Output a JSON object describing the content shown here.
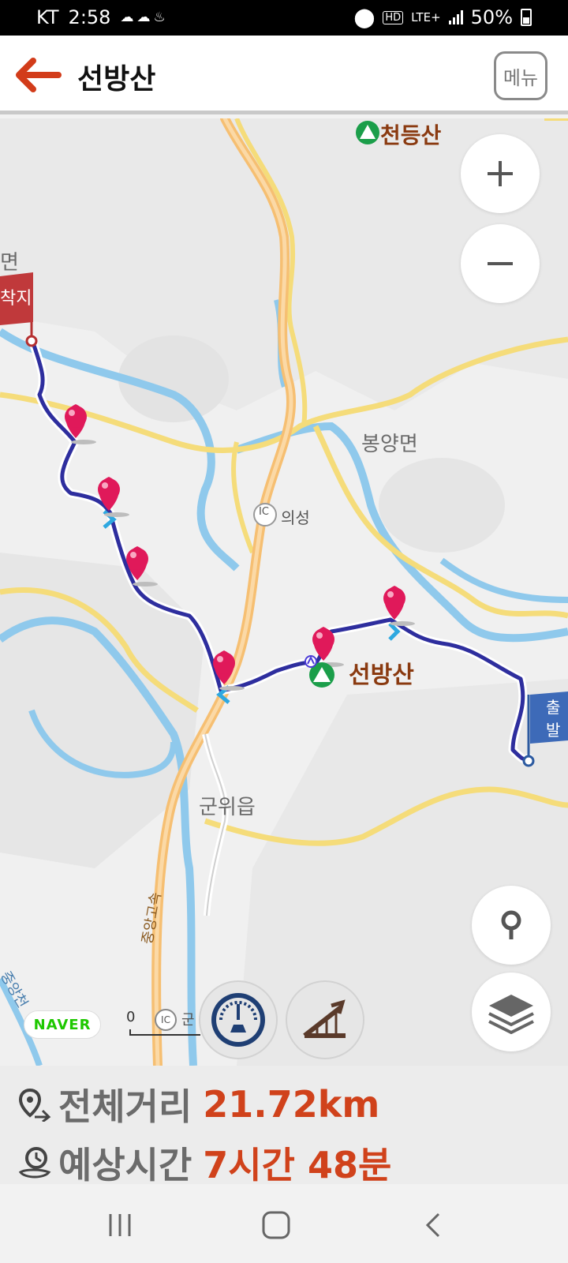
{
  "status": {
    "carrier": "KT",
    "time": "2:58",
    "network": "HD",
    "lte": "LTE+",
    "battery": "50%"
  },
  "header": {
    "title": "선방산",
    "menu_label": "메뉴"
  },
  "map": {
    "labels": {
      "cheondeungsan": "천등산",
      "myeon_left": "면",
      "arrival_flag": "착지",
      "bongyang": "봉양면",
      "ic_badge": "IC",
      "uiseong": "의성",
      "seonbangsan": "선방산",
      "departure_flag": "출발",
      "gunwi": "군위읍",
      "expressway": "중앙고속",
      "stream": "중앙천",
      "scale_zero": "0",
      "scale_ic": "IC",
      "scale_gun": "군"
    },
    "naver": "NAVER"
  },
  "info": {
    "distance_label": "전체거리",
    "distance_value": "21.72km",
    "time_label": "예상시간",
    "time_value": "7시간 48분"
  },
  "theme": {
    "accent": "#d0421b",
    "route": "#2e2e9e",
    "pin": "#e0195a"
  }
}
